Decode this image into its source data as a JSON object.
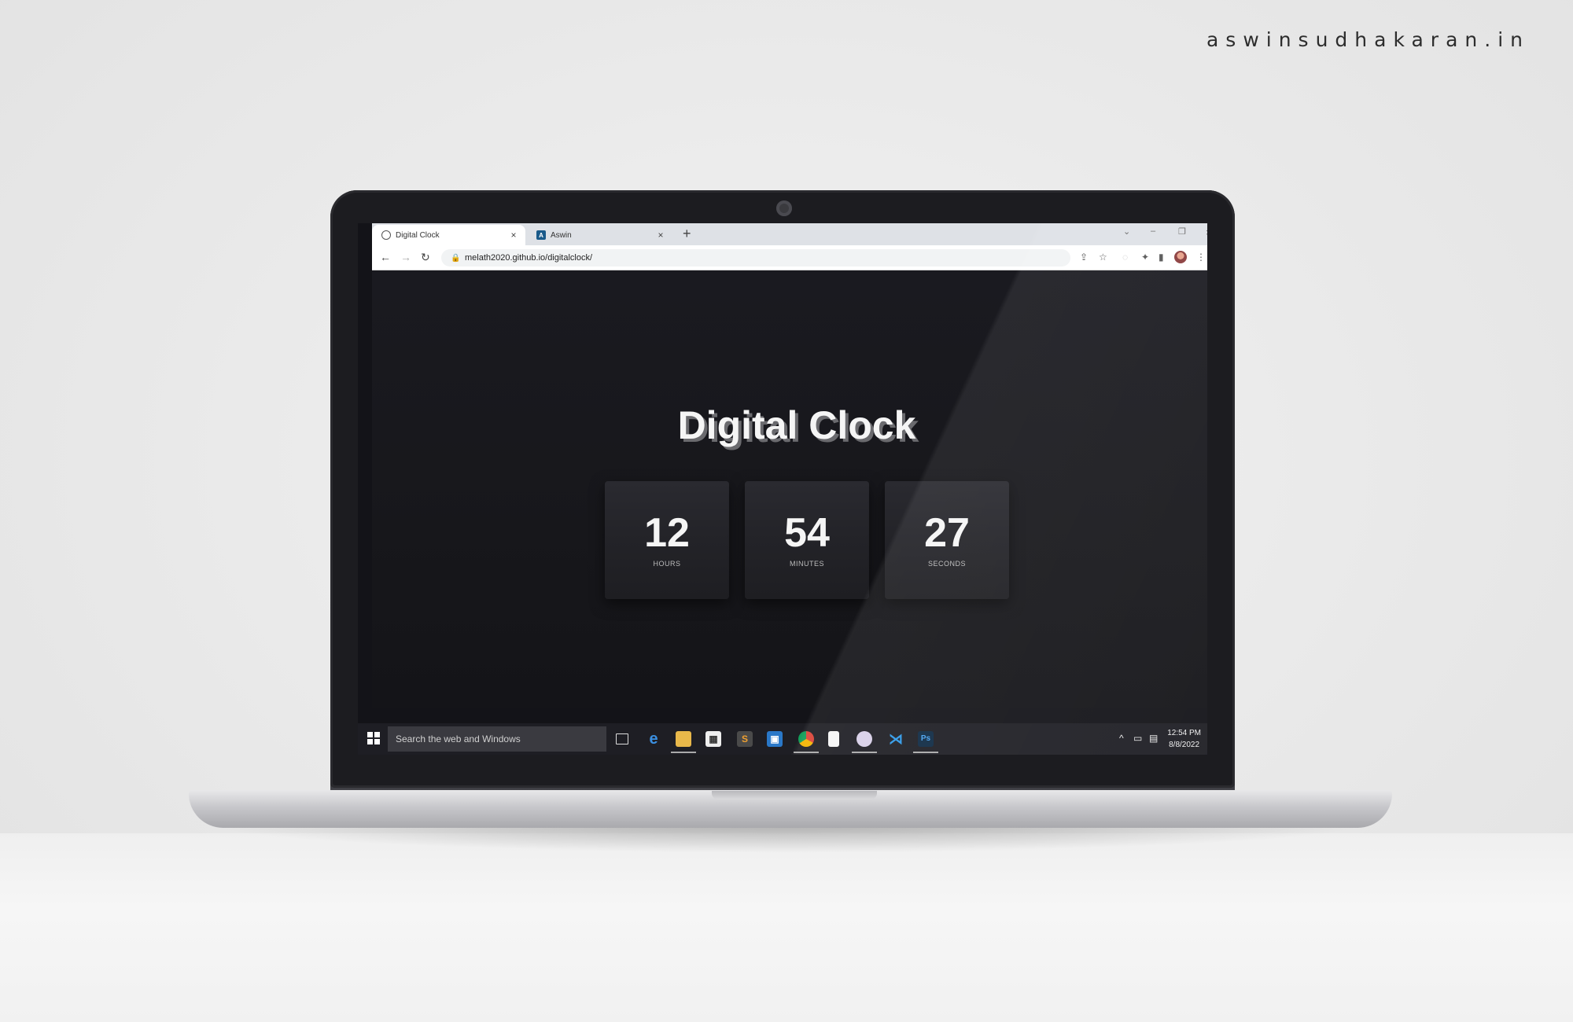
{
  "watermark": "aswinsudhakaran.in",
  "browser": {
    "tabs": [
      {
        "label": "Digital Clock",
        "close": "×"
      },
      {
        "label": "Aswin",
        "close": "×"
      }
    ],
    "new_tab": "+",
    "url": "melath2020.github.io/digitalclock/",
    "nav": {
      "back": "←",
      "forward": "→",
      "reload": "↻"
    },
    "window_controls": {
      "minimize": "–",
      "restore": "❐",
      "close": "×",
      "tab_list": "⌄"
    }
  },
  "clock": {
    "title": "Digital Clock",
    "units": [
      {
        "value": "12",
        "label": "HOURS"
      },
      {
        "value": "54",
        "label": "MINUTES"
      },
      {
        "value": "27",
        "label": "SECONDS"
      }
    ]
  },
  "taskbar": {
    "search_placeholder": "Search the web and Windows",
    "time": "12:54 PM",
    "date": "8/8/2022",
    "apps": [
      "task-view-icon",
      "edge-icon",
      "file-explorer-icon",
      "store-icon",
      "sublime-icon",
      "outlook-icon",
      "chrome-icon",
      "file-icon",
      "paint-icon",
      "vscode-icon",
      "photoshop-icon"
    ]
  },
  "colors": {
    "page_bg": "#17171b",
    "card_bg": "#25252a",
    "title_shadow": "#6a6a6e",
    "taskbar": "#1e1e24"
  }
}
